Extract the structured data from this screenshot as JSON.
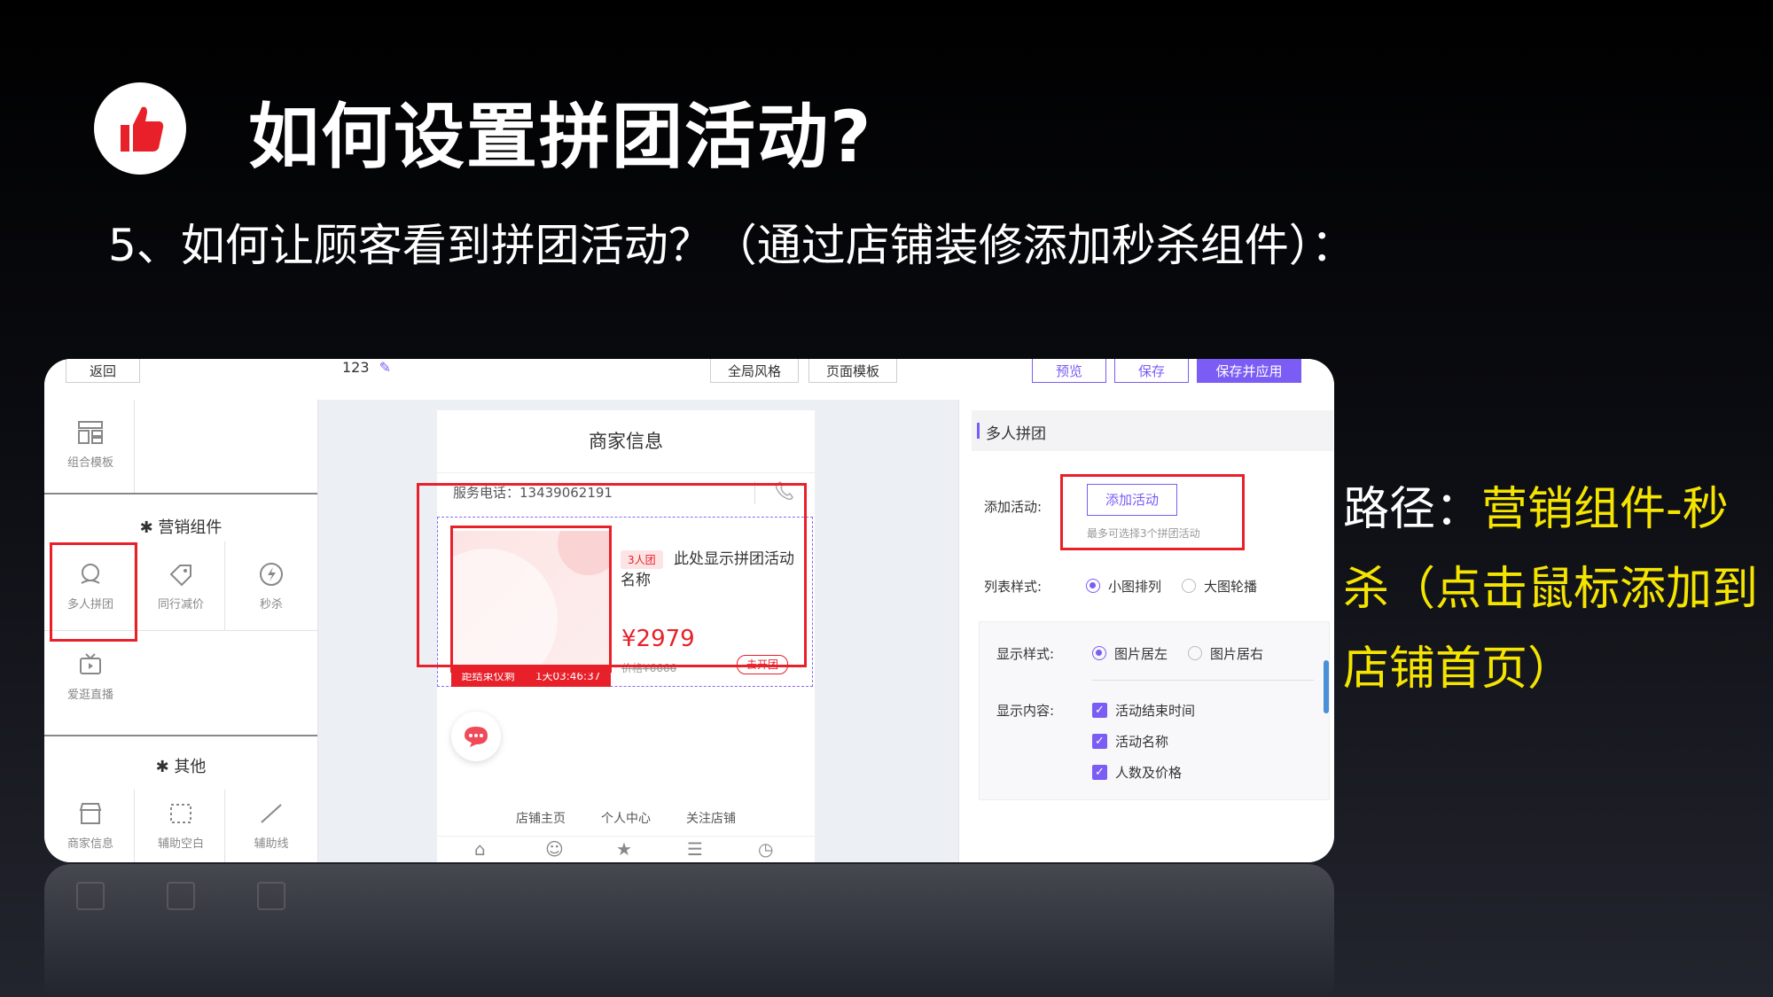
{
  "slide": {
    "title": "如何设置拼团活动?",
    "subtitle": "5、如何让顾客看到拼团活动？（通过店铺装修添加秒杀组件）：",
    "path_label": "路径：",
    "path_text": "营销组件-秒杀（点击鼠标添加到店铺首页）",
    "logo_icon": "thumbs-up-icon",
    "accent_color": "#e8202a",
    "highlight_color": "#f5e400"
  },
  "editor": {
    "topbar": {
      "back_label": "返回",
      "page_name": "123",
      "global_style_label": "全局风格",
      "page_template_label": "页面模板",
      "preview_label": "预览",
      "save_label": "保存",
      "save_apply_label": "保存并应用"
    },
    "left_panel": {
      "combo_template_label": "组合模板",
      "marketing_section": "营销组件",
      "marketing_items": [
        "多人拼团",
        "同行减价",
        "秒杀",
        "爱逛直播"
      ],
      "other_section": "其他",
      "other_items": [
        "商家信息",
        "辅助空白",
        "辅助线"
      ]
    },
    "phone": {
      "header_title": "商家信息",
      "phone_label": "服务电话：13439062191",
      "badge": "3人团",
      "product_name": "此处显示拼团活动名称",
      "price": "¥2979",
      "original_price": "价格¥6666",
      "countdown_label": "距结束仅剩",
      "countdown_value": "1天03:46:37",
      "go_group_label": "去开团",
      "footer_links": [
        "店铺主页",
        "个人中心",
        "关注店铺"
      ]
    },
    "settings": {
      "section_title": "多人拼团",
      "add_activity_label": "添加活动:",
      "add_activity_button": "添加活动",
      "add_activity_hint": "最多可选择3个拼团活动",
      "list_style_label": "列表样式:",
      "list_style_options": [
        "小图排列",
        "大图轮播"
      ],
      "display_style_label": "显示样式:",
      "display_style_options": [
        "图片居左",
        "图片居右"
      ],
      "display_content_label": "显示内容:",
      "display_content_options": [
        "活动结束时间",
        "活动名称",
        "人数及价格"
      ]
    }
  }
}
